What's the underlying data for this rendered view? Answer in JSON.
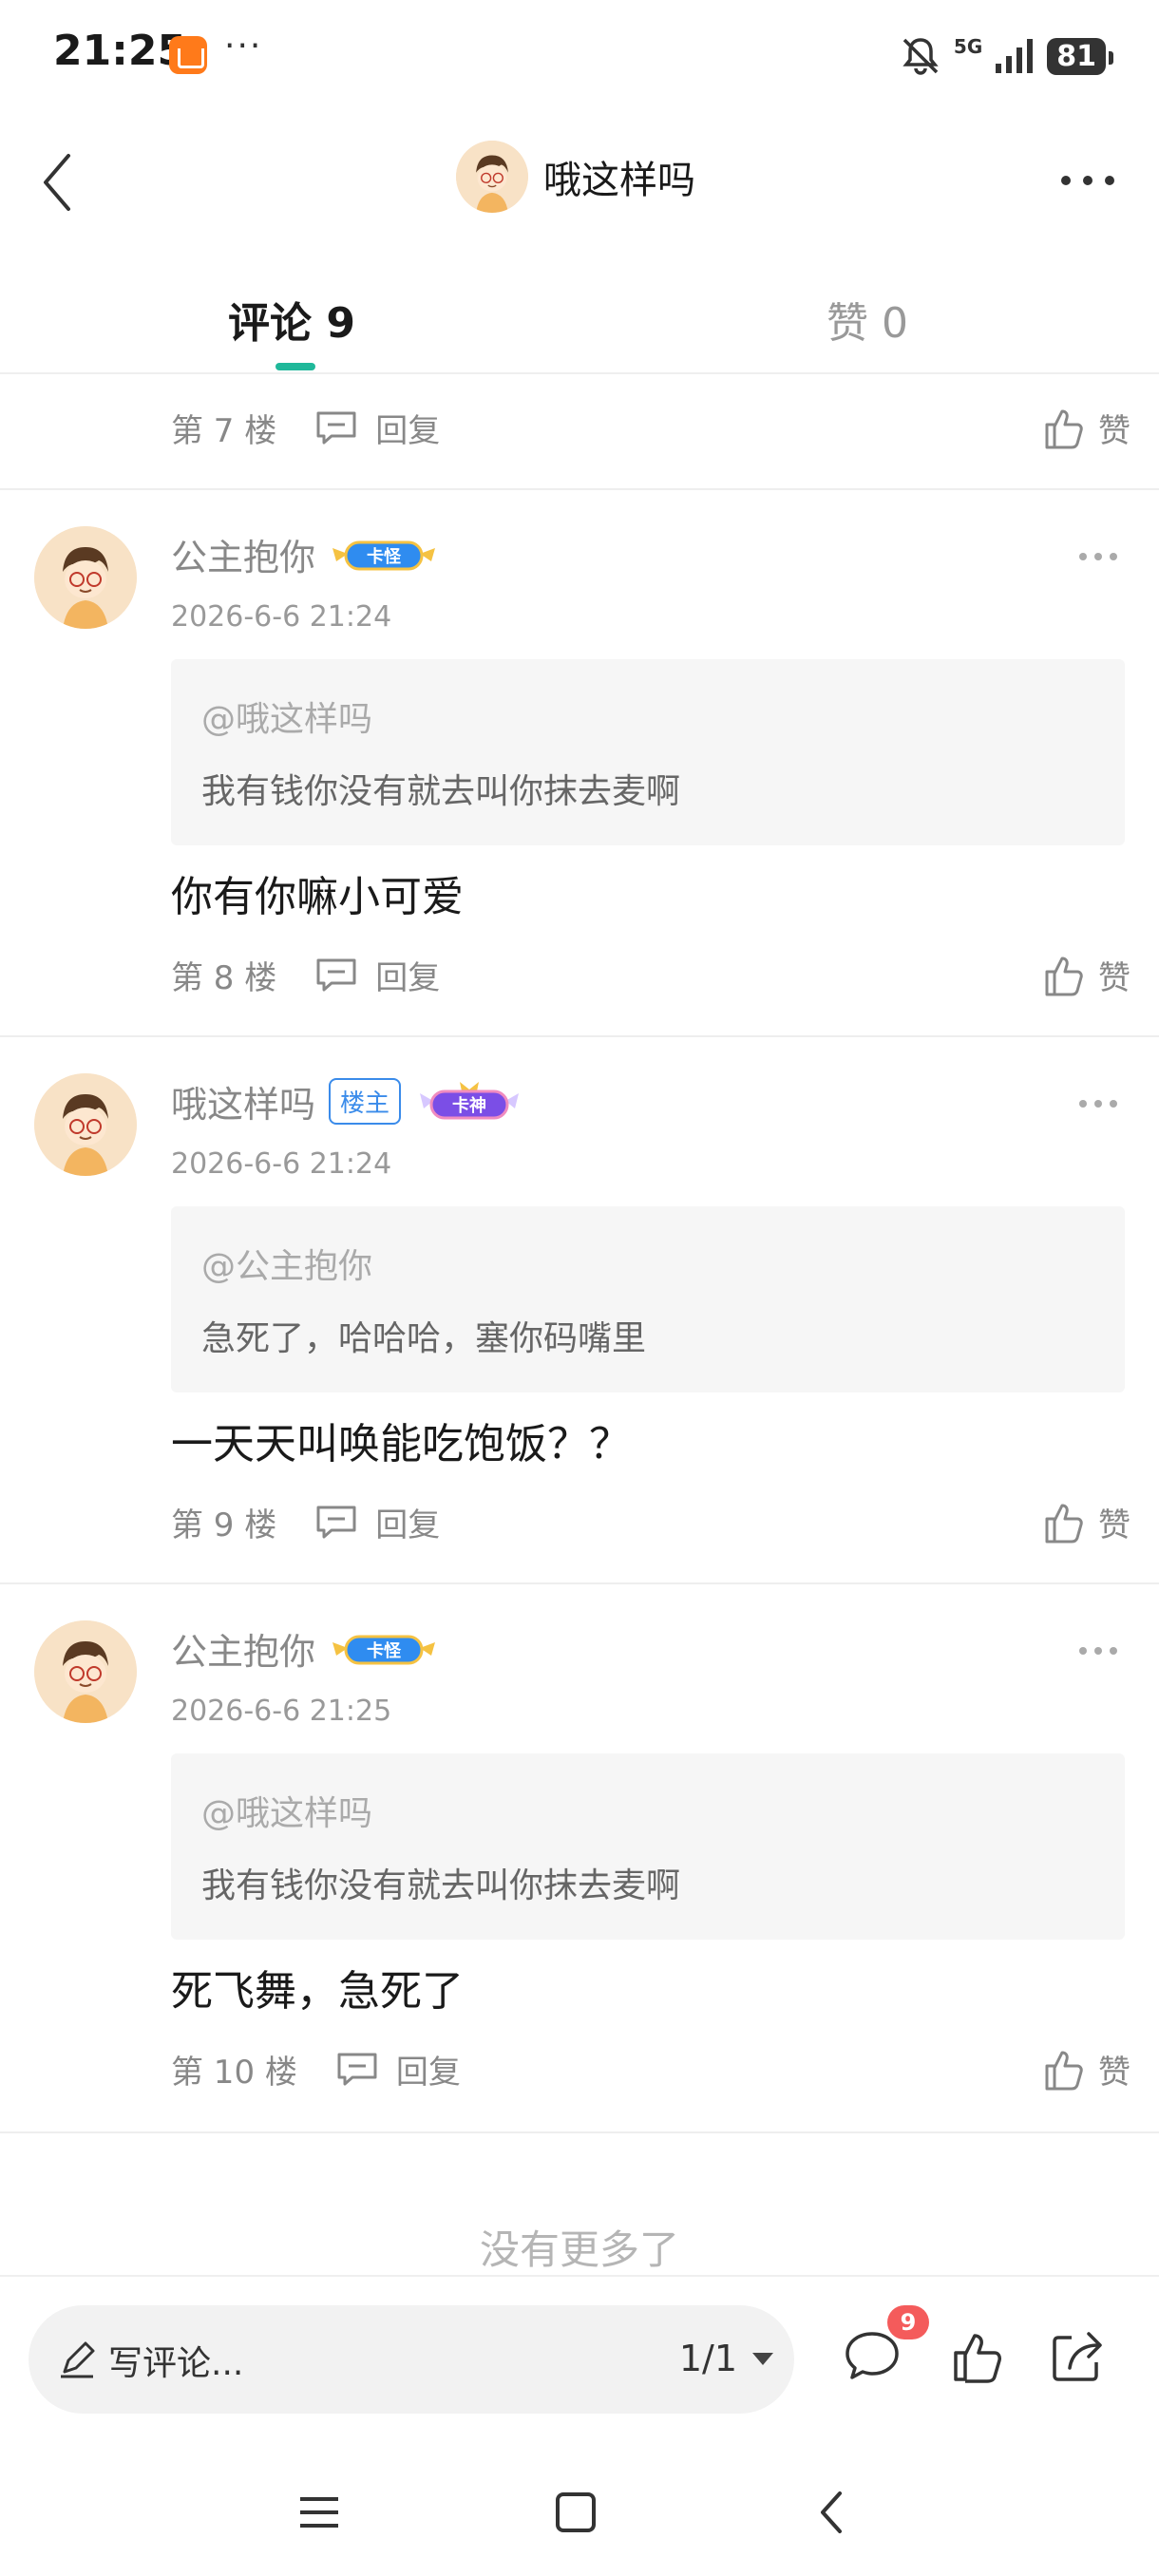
{
  "status_bar": {
    "time": "21:25",
    "dots": "···",
    "network": "5G",
    "battery": "81"
  },
  "header": {
    "title": "哦这样吗"
  },
  "tabs": [
    {
      "label": "评论 9",
      "active": true
    },
    {
      "label": "赞 0",
      "active": false
    }
  ],
  "top_floor": {
    "floor": "第 7 楼",
    "reply_label": "回复",
    "like_label": "赞"
  },
  "comments": [
    {
      "username": "公主抱你",
      "is_op": false,
      "rank_badge": "卡怪",
      "time": "2026-6-6 21:24",
      "quote_user": "@哦这样吗",
      "quote_text": "我有钱你没有就去叫你抹去麦啊",
      "text": "你有你嘛小可爱",
      "floor": "第 8 楼",
      "reply_label": "回复",
      "like_label": "赞"
    },
    {
      "username": "哦这样吗",
      "is_op": true,
      "op_label": "楼主",
      "rank_badge": "卡神",
      "time": "2026-6-6 21:24",
      "quote_user": "@公主抱你",
      "quote_text": "急死了，哈哈哈，塞你码嘴里",
      "text": "一天天叫唤能吃饱饭？？",
      "floor": "第 9 楼",
      "reply_label": "回复",
      "like_label": "赞"
    },
    {
      "username": "公主抱你",
      "is_op": false,
      "rank_badge": "卡怪",
      "time": "2026-6-6 21:25",
      "quote_user": "@哦这样吗",
      "quote_text": "我有钱你没有就去叫你抹去麦啊",
      "text": "死飞舞，急死了",
      "floor": "第 10 楼",
      "reply_label": "回复",
      "like_label": "赞"
    }
  ],
  "no_more_text": "没有更多了",
  "bottom_bar": {
    "placeholder": "写评论...",
    "page": "1/1",
    "comment_count": "9"
  },
  "colors": {
    "accent": "#1fb89a",
    "badge_red": "#f45b5b",
    "op_blue": "#3a8bea"
  }
}
